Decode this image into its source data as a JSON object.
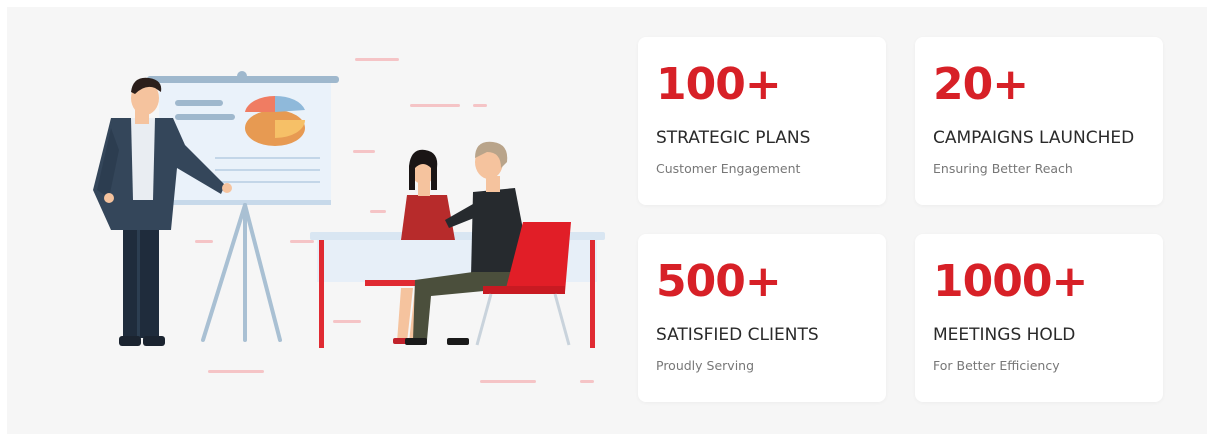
{
  "stats": [
    {
      "number": "100+",
      "title": "STRATEGIC PLANS",
      "subtitle": "Customer Engagement"
    },
    {
      "number": "20+",
      "title": "CAMPAIGNS LAUNCHED",
      "subtitle": "Ensuring Better Reach"
    },
    {
      "number": "500+",
      "title": "SATISFIED CLIENTS",
      "subtitle": "Proudly Serving"
    },
    {
      "number": "1000+",
      "title": "MEETINGS HOLD",
      "subtitle": "For Better Efficiency"
    }
  ],
  "colors": {
    "accent": "#d72027",
    "card_bg": "#ffffff",
    "section_bg": "#f6f6f6"
  },
  "illustration": "business-meeting-presentation-illustration"
}
